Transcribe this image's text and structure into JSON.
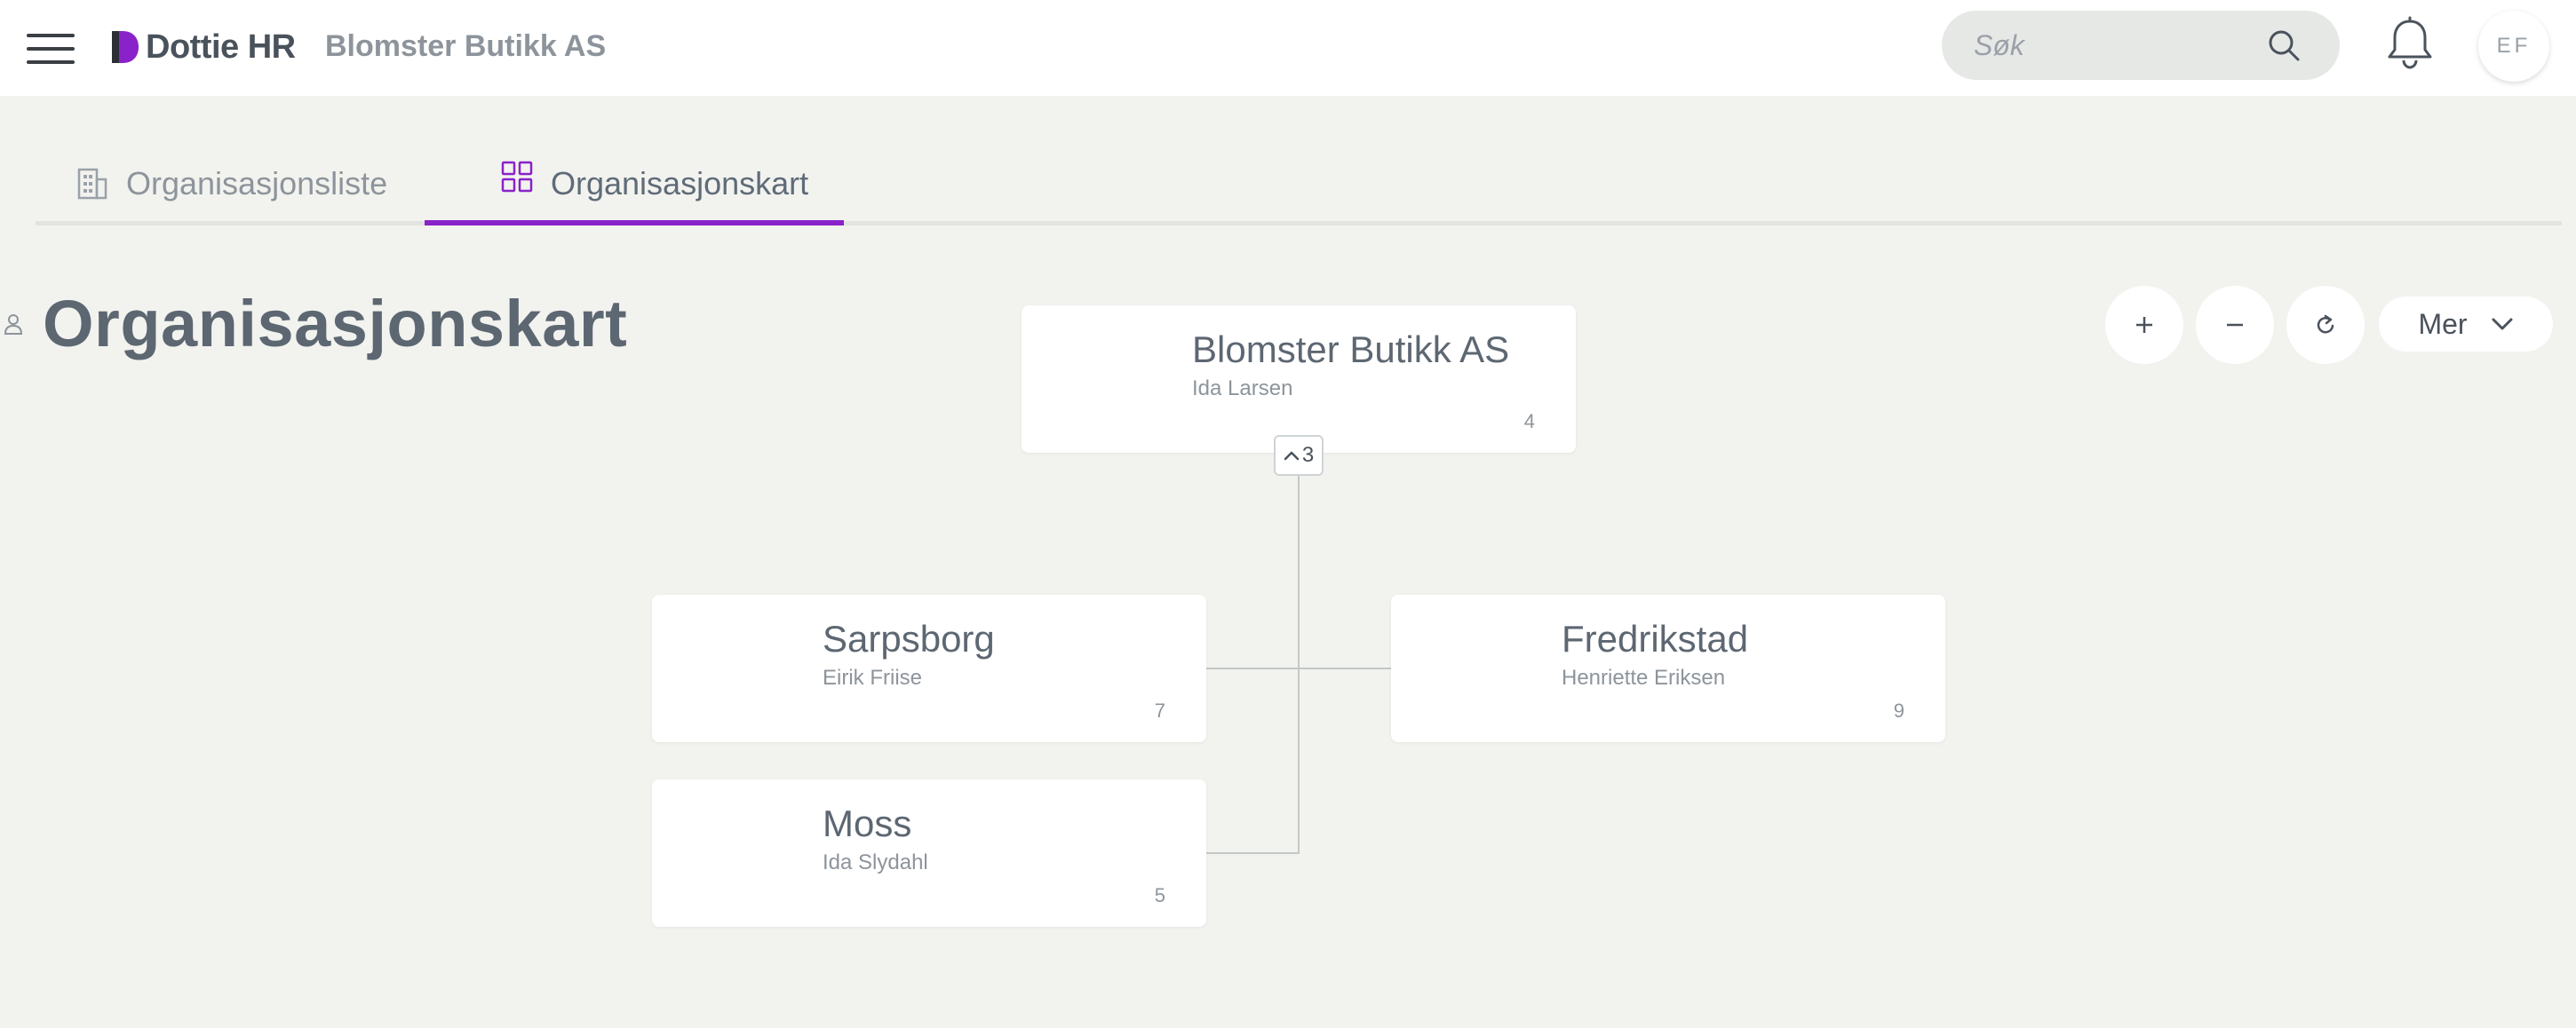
{
  "header": {
    "brand": "Dottie HR",
    "company": "Blomster Butikk AS",
    "search_placeholder": "Søk",
    "avatar_initials": "EF"
  },
  "tabs": [
    {
      "label": "Organisasjonsliste",
      "active": false
    },
    {
      "label": "Organisasjonskart",
      "active": true
    }
  ],
  "page": {
    "title": "Organisasjonskart"
  },
  "controls": {
    "more_label": "Mer"
  },
  "orgchart": {
    "root": {
      "name": "Blomster Butikk AS",
      "manager": "Ida Larsen",
      "count": "4",
      "children_toggle": "3"
    },
    "children": [
      {
        "name": "Sarpsborg",
        "manager": "Eirik Friise",
        "count": "7"
      },
      {
        "name": "Fredrikstad",
        "manager": "Henriette Eriksen",
        "count": "9"
      },
      {
        "name": "Moss",
        "manager": "Ida Slydahl",
        "count": "5"
      }
    ]
  },
  "colors": {
    "accent": "#8a22c9",
    "background": "#f2f3ef",
    "card": "#ffffff",
    "text": "#5d6772",
    "muted": "#8d949b"
  }
}
